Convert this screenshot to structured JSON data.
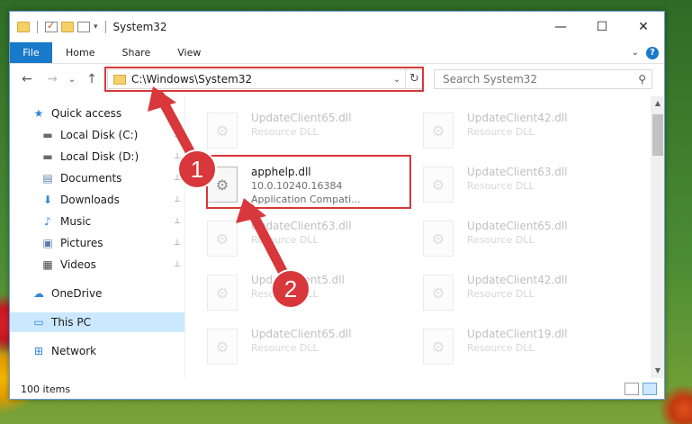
{
  "window": {
    "title": "System32",
    "controls": {
      "minimize": "—",
      "maximize": "☐",
      "close": "✕"
    }
  },
  "ribbon": {
    "tabs": [
      "File",
      "Home",
      "Share",
      "View"
    ],
    "help": "?"
  },
  "nav": {
    "back": "←",
    "forward": "→",
    "recent": "⌄",
    "up": "↑",
    "address": "C:\\Windows\\System32",
    "search_placeholder": "Search System32"
  },
  "sidebar": {
    "items": [
      {
        "label": "Quick access",
        "icon": "star-icon",
        "glyph": "★",
        "color": "#2f86d6"
      },
      {
        "label": "Local Disk (C:)",
        "icon": "drive-icon",
        "glyph": "▬",
        "color": "#6b6b6b"
      },
      {
        "label": "Local Disk (D:)",
        "icon": "drive-icon",
        "glyph": "▬",
        "color": "#6b6b6b"
      },
      {
        "label": "Documents",
        "icon": "documents-icon",
        "glyph": "▤",
        "color": "#5a7fa8"
      },
      {
        "label": "Downloads",
        "icon": "download-icon",
        "glyph": "⬇",
        "color": "#2f86d6"
      },
      {
        "label": "Music",
        "icon": "music-icon",
        "glyph": "♪",
        "color": "#2f86d6"
      },
      {
        "label": "Pictures",
        "icon": "pictures-icon",
        "glyph": "▣",
        "color": "#5a7fa8"
      },
      {
        "label": "Videos",
        "icon": "videos-icon",
        "glyph": "▦",
        "color": "#444444"
      },
      {
        "label": "OneDrive",
        "icon": "cloud-icon",
        "glyph": "☁",
        "color": "#2f86d6"
      },
      {
        "label": "This PC",
        "icon": "computer-icon",
        "glyph": "▭",
        "color": "#2f86d6"
      },
      {
        "label": "Network",
        "icon": "network-icon",
        "glyph": "⊞",
        "color": "#2f86d6"
      }
    ],
    "pin_glyph": "📌"
  },
  "files": [
    {
      "name": "UpdateClient65.dll",
      "line1": "Resource DLL",
      "line2": ""
    },
    {
      "name": "UpdateClient42.dll",
      "line1": "Resource DLL",
      "line2": ""
    },
    {
      "name": "apphelp.dll",
      "line1": "10.0.10240.16384",
      "line2": "Application Compati..."
    },
    {
      "name": "UpdateClient63.dll",
      "line1": "Resource DLL",
      "line2": ""
    },
    {
      "name": "UpdateClient63.dll",
      "line1": "Resource DLL",
      "line2": ""
    },
    {
      "name": "UpdateClient65.dll",
      "line1": "Resource DLL",
      "line2": ""
    },
    {
      "name": "UpdateClient5.dll",
      "line1": "Resource DLL",
      "line2": ""
    },
    {
      "name": "UpdateClient42.dll",
      "line1": "Resource DLL",
      "line2": ""
    },
    {
      "name": "UpdateClient65.dll",
      "line1": "Resource DLL",
      "line2": ""
    },
    {
      "name": "UpdateClient19.dll",
      "line1": "Resource DLL",
      "line2": ""
    }
  ],
  "status": {
    "count": "100 items"
  },
  "annotations": {
    "step1": "1",
    "step2": "2",
    "color": "#d8373b"
  }
}
